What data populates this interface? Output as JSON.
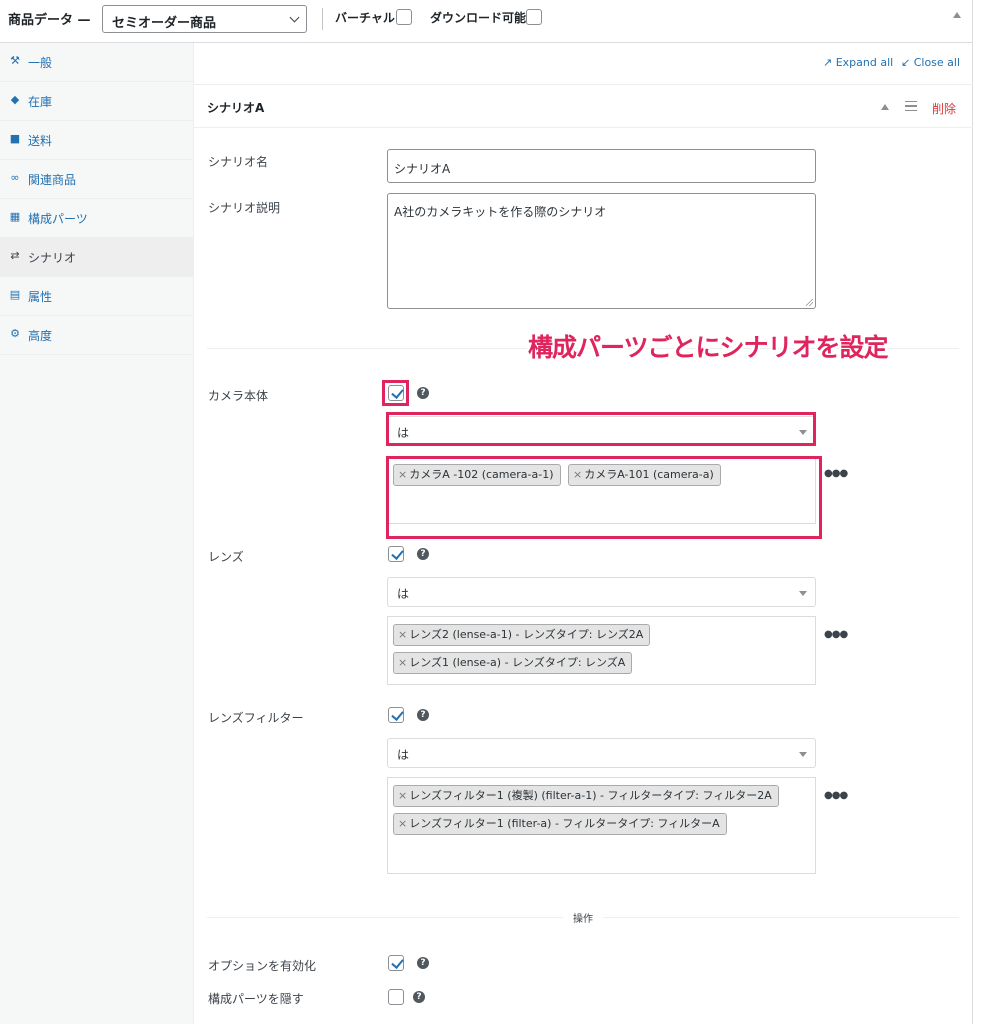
{
  "header": {
    "title": "商品データ —",
    "product_type": "セミオーダー商品",
    "virtual_label": "バーチャル:",
    "downloadable_label": "ダウンロード可能:"
  },
  "sidebar": {
    "items": [
      {
        "label": "一般",
        "icon": "wrench-icon"
      },
      {
        "label": "在庫",
        "icon": "tag-icon"
      },
      {
        "label": "送料",
        "icon": "truck-icon"
      },
      {
        "label": "関連商品",
        "icon": "link-icon"
      },
      {
        "label": "構成パーツ",
        "icon": "cubes-icon"
      },
      {
        "label": "シナリオ",
        "icon": "shuffle-icon",
        "active": true
      },
      {
        "label": "属性",
        "icon": "list-icon"
      },
      {
        "label": "高度",
        "icon": "gear-icon"
      }
    ]
  },
  "toolbar": {
    "expand_all": "Expand all",
    "close_all": "Close all"
  },
  "scenario": {
    "title": "シナリオA",
    "delete_label": "削除",
    "name_label": "シナリオ名",
    "name_value": "シナリオA",
    "desc_label": "シナリオ説明",
    "desc_value": "A社のカメラキットを作る際のシナリオ",
    "components": [
      {
        "label": "カメラ本体",
        "checked": true,
        "condition": "は",
        "tags": [
          "カメラA -102 (camera-a-1)",
          "カメラA-101 (camera-a)"
        ]
      },
      {
        "label": "レンズ",
        "checked": true,
        "condition": "は",
        "tags": [
          "レンズ2 (lense-a-1) - レンズタイプ: レンズ2A",
          "レンズ1 (lense-a) - レンズタイプ: レンズA"
        ]
      },
      {
        "label": "レンズフィルター",
        "checked": true,
        "condition": "は",
        "tags": [
          "レンズフィルター1 (複製) (filter-a-1) - フィルタータイプ: フィルター2A",
          "レンズフィルター1 (filter-a) - フィルタータイプ: フィルターA"
        ]
      }
    ],
    "actions_label": "操作",
    "options": [
      {
        "label": "オプションを有効化",
        "checked": true
      },
      {
        "label": "構成パーツを隠す",
        "checked": false
      }
    ]
  },
  "annotation": {
    "text": "構成パーツごとにシナリオを設定",
    "color": "#e0245e"
  }
}
